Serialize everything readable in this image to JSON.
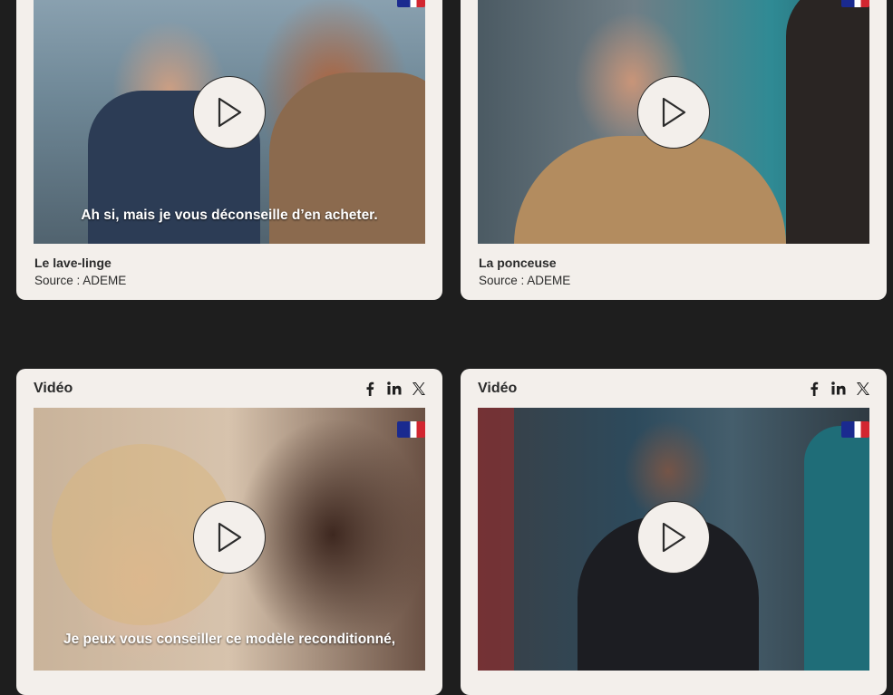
{
  "colors": {
    "page_background": "#1e1e1e",
    "card_background": "#f3efeb",
    "text": "#2b2b2b"
  },
  "share_icons": [
    "facebook-icon",
    "linkedin-icon",
    "x-icon"
  ],
  "cards_top": [
    {
      "title": "Le lave-linge",
      "source": "Source : ADEME",
      "subtitle": "Ah si, mais je vous déconseille d’en acheter."
    },
    {
      "title": "La ponceuse",
      "source": "Source : ADEME",
      "subtitle": ""
    }
  ],
  "cards_bottom": [
    {
      "type_label": "Vidéo",
      "subtitle": "Je peux vous conseiller ce modèle reconditionné,"
    },
    {
      "type_label": "Vidéo",
      "subtitle": ""
    }
  ]
}
